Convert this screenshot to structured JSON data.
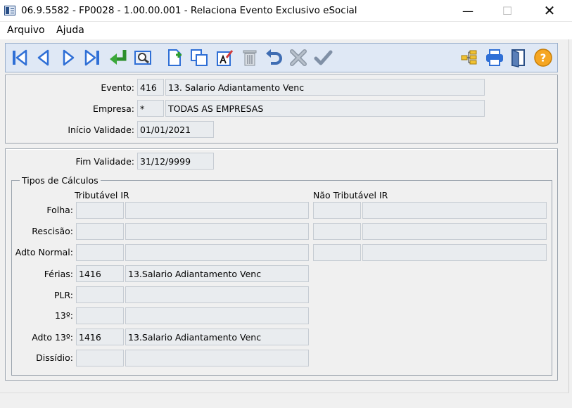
{
  "window": {
    "title": "06.9.5582 - FP0028 - 1.00.00.001 - Relaciona Evento Exclusivo eSocial",
    "min_glyph": "—",
    "max_glyph": "☐",
    "close_glyph": "✕"
  },
  "menu": {
    "items": [
      {
        "label": "Arquivo"
      },
      {
        "label": "Ajuda"
      }
    ]
  },
  "colors": {
    "toolbar_bg": "#dfe8f5",
    "icon_blue": "#2f6fd6",
    "field_bg": "#e9ecef",
    "help_orange": "#f5a623"
  },
  "toolbar": {
    "icons": [
      "first-record-icon",
      "previous-record-icon",
      "next-record-icon",
      "last-record-icon",
      "go-to-icon",
      "search-icon",
      "new-icon",
      "copy-icon",
      "edit-icon",
      "delete-icon",
      "undo-icon",
      "cancel-icon",
      "save-icon",
      "tree-icon",
      "print-icon",
      "exit-icon",
      "help-icon"
    ],
    "help_label": "?"
  },
  "form": {
    "evento_label": "Evento:",
    "evento_code": "416",
    "evento_desc": "13. Salario Adiantamento Venc",
    "empresa_label": "Empresa:",
    "empresa_code": "*",
    "empresa_desc": "TODAS AS EMPRESAS",
    "inicio_label": "Início Validade:",
    "inicio_value": "01/01/2021",
    "fim_label": "Fim Validade:",
    "fim_value": "31/12/9999"
  },
  "calculos": {
    "group_title": "Tipos de Cálculos",
    "col_tributavel": "Tributável IR",
    "col_nao_tributavel": "Não Tributável IR",
    "rows": [
      {
        "label": "Folha:",
        "trib_code": "",
        "trib_desc": "",
        "nao_code": "",
        "nao_desc": ""
      },
      {
        "label": "Rescisão:",
        "trib_code": "",
        "trib_desc": "",
        "nao_code": "",
        "nao_desc": ""
      },
      {
        "label": "Adto Normal:",
        "trib_code": "",
        "trib_desc": "",
        "nao_code": "",
        "nao_desc": ""
      },
      {
        "label": "Férias:",
        "trib_code": "1416",
        "trib_desc": "13.Salario Adiantamento Venc"
      },
      {
        "label": "PLR:",
        "trib_code": "",
        "trib_desc": ""
      },
      {
        "label": "13º:",
        "trib_code": "",
        "trib_desc": ""
      },
      {
        "label": "Adto 13º:",
        "trib_code": "1416",
        "trib_desc": "13.Salario Adiantamento Venc"
      },
      {
        "label": "Dissídio:",
        "trib_code": "",
        "trib_desc": ""
      }
    ]
  }
}
